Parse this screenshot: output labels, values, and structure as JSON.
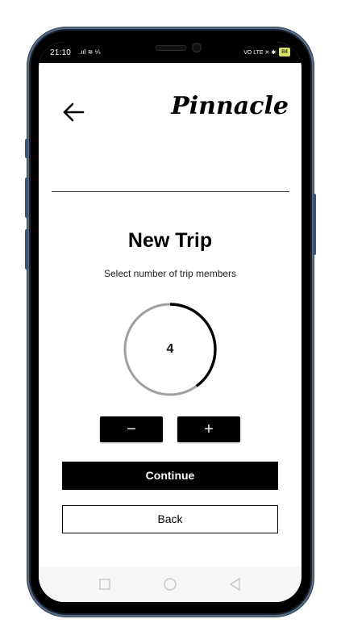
{
  "status_bar": {
    "time": "21:10",
    "left_icons": ".ııl ≋ ⁶⁄ₖ",
    "right_icons": "VO LTE ✕ ✱",
    "battery": "84"
  },
  "header": {
    "logo": "Pinnacle"
  },
  "main": {
    "title": "New Trip",
    "subtitle": "Select number of trip members",
    "member_count": "4",
    "ring_progress": 0.4,
    "minus_label": "−",
    "plus_label": "+",
    "continue_label": "Continue",
    "back_label": "Back"
  },
  "colors": {
    "ring_active": "#000000",
    "ring_track": "#a0a0a0",
    "button_bg": "#000000",
    "button_text": "#ffffff"
  },
  "icons": [
    "back-arrow-icon",
    "square-nav-icon",
    "circle-nav-icon",
    "triangle-nav-icon"
  ]
}
